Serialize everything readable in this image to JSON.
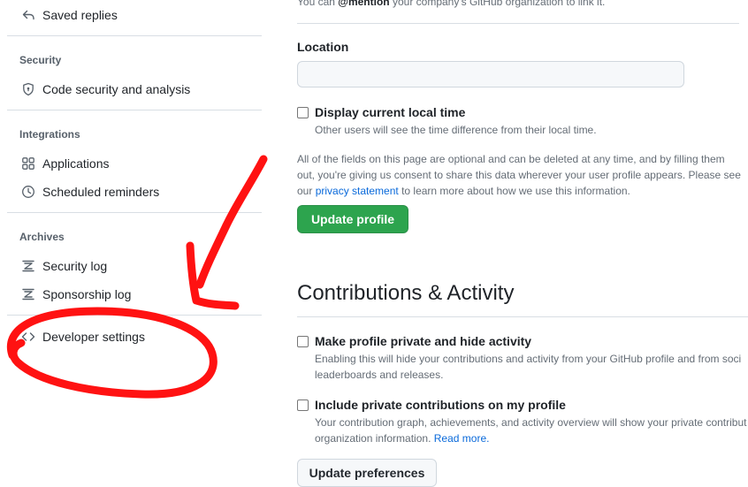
{
  "sidebar": {
    "saved_replies": "Saved replies",
    "security_heading": "Security",
    "code_security": "Code security and analysis",
    "integrations_heading": "Integrations",
    "applications": "Applications",
    "scheduled_reminders": "Scheduled reminders",
    "archives_heading": "Archives",
    "security_log": "Security log",
    "sponsorship_log": "Sponsorship log",
    "developer_settings": "Developer settings"
  },
  "main": {
    "mention_note_prefix": "You can ",
    "mention_bold": "@mention",
    "mention_note_suffix": " your company's GitHub organization to link it.",
    "location_label": "Location",
    "location_value": "",
    "local_time_label": "Display current local time",
    "local_time_note": "Other users will see the time difference from their local time.",
    "optional_note_1": "All of the fields on this page are optional and can be deleted at any time, and by filling them",
    "optional_note_2": "out, you're giving us consent to share this data wherever your user profile appears. Please see",
    "optional_note_3_prefix": "our ",
    "privacy_link": "privacy statement",
    "optional_note_3_suffix": " to learn more about how we use this information.",
    "update_profile_button": "Update profile",
    "contributions_heading": "Contributions & Activity",
    "private_label": "Make profile private and hide activity",
    "private_note_1": "Enabling this will hide your contributions and activity from your GitHub profile and from soci",
    "private_note_2": "leaderboards and releases.",
    "include_private_label": "Include private contributions on my profile",
    "include_note_1": "Your contribution graph, achievements, and activity overview will show your private contribut",
    "include_note_2_prefix": "organization information. ",
    "read_more_link": "Read more.",
    "update_preferences_button": "Update preferences"
  },
  "colors": {
    "accent_green": "#2da44e",
    "link_blue": "#0969da",
    "annotation_red": "#ff0000"
  }
}
